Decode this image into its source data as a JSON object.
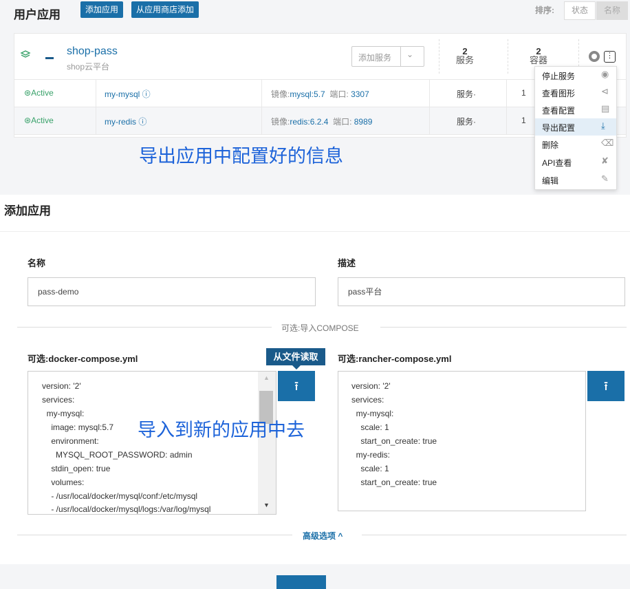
{
  "header": {
    "title": "用户应用",
    "add_app": "添加应用",
    "add_from_store": "从应用商店添加",
    "sort_label": "排序:",
    "sort_state": "状态",
    "sort_name": "名称"
  },
  "stack": {
    "name": "shop-pass",
    "description": "shop云平台",
    "add_service": "添加服务",
    "services_count": "2",
    "services_label": "服务",
    "containers_count": "2",
    "containers_label": "容器",
    "rows": [
      {
        "state": "Active",
        "name": "my-mysql",
        "image_label": "镜像:",
        "image": "mysql:5.7",
        "port_label": "端口:",
        "port": "3307",
        "kind": "服务·",
        "count": "1"
      },
      {
        "state": "Active",
        "name": "my-redis",
        "image_label": "镜像:",
        "image": "redis:6.2.4",
        "port_label": "端口:",
        "port": "8989",
        "kind": "服务·",
        "count": "1"
      }
    ]
  },
  "dropdown": {
    "items": [
      {
        "label": "停止服务",
        "icon": "stop-icon"
      },
      {
        "label": "查看图形",
        "icon": "share-icon"
      },
      {
        "label": "查看配置",
        "icon": "document-icon"
      },
      {
        "label": "导出配置",
        "icon": "download-icon"
      },
      {
        "label": "删除",
        "icon": "trash-icon"
      },
      {
        "label": "API查看",
        "icon": "link-icon"
      },
      {
        "label": "编辑",
        "icon": "pencil-icon"
      }
    ]
  },
  "annotations": {
    "export_note": "导出应用中配置好的信息",
    "import_note": "导入到新的应用中去"
  },
  "add_app": {
    "title": "添加应用",
    "name_label": "名称",
    "name_value": "pass-demo",
    "desc_label": "描述",
    "desc_value": "pass平台",
    "import_divider": "可选:导入COMPOSE",
    "docker_label": "可选:docker-compose.yml",
    "rancher_label": "可选:rancher-compose.yml",
    "read_file_tooltip": "从文件读取",
    "docker_lines": [
      "version: '2'",
      "services:",
      "  my-mysql:",
      "    image: mysql:5.7",
      "    environment:",
      "      MYSQL_ROOT_PASSWORD: admin",
      "    stdin_open: true",
      "    volumes:",
      "    - /usr/local/docker/mysql/conf:/etc/mysql",
      "    - /usr/local/docker/mysql/logs:/var/log/mysql"
    ],
    "rancher_lines": [
      "version: '2'",
      "services:",
      "  my-mysql:",
      "    scale: 1",
      "    start_on_create: true",
      "  my-redis:",
      "    scale: 1",
      "    start_on_create: true"
    ],
    "advanced": "高级选项 ^"
  }
}
